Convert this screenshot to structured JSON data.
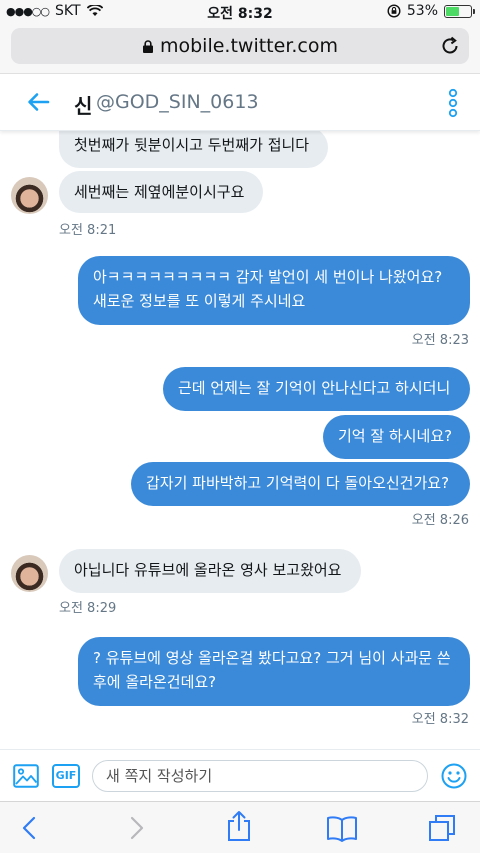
{
  "status_bar": {
    "signal": "●●●○○",
    "carrier": "SKT",
    "time": "오전 8:32",
    "battery": "53%",
    "battery_level": 0.53
  },
  "browser": {
    "url": "mobile.twitter.com"
  },
  "dm_header": {
    "name": "신",
    "handle": "@GOD_SIN_0613"
  },
  "messages": [
    {
      "direction": "received",
      "text": "첫번째가 뒷분이시고 두번째가 접니다"
    },
    {
      "direction": "received",
      "text": "세번째는 제옆에분이시구요"
    },
    {
      "direction": "received",
      "time": "오전 8:21"
    },
    {
      "direction": "sent",
      "text": "아ㅋㅋㅋㅋㅋㅋㅋㅋㅋ 감자 발언이 세 번이나 나왔어요? 새로운 정보를 또 이렇게 주시네요",
      "time": "오전 8:23"
    },
    {
      "direction": "sent",
      "text": "근데 언제는 잘 기억이 안나신다고 하시더니"
    },
    {
      "direction": "sent",
      "text": "기억 잘 하시네요?"
    },
    {
      "direction": "sent",
      "text": "갑자기 파바박하고 기억력이 다 돌아오신건가요?",
      "time": "오전 8:26"
    },
    {
      "direction": "received",
      "text": "아닙니다 유튜브에 올라온 영사 보고왔어요",
      "time": "오전 8:29"
    },
    {
      "direction": "sent",
      "text": "? 유튜브에 영상 올라온걸 봤다고요? 그거 님이 사과문 쓴 후에 올라온건데요?",
      "time": "오전 8:32"
    }
  ],
  "compose": {
    "placeholder": "새 쪽지 작성하기",
    "gif_label": "GIF"
  },
  "colors": {
    "sent_bubble": "#3a8ad9",
    "received_bubble": "#e6ecf0",
    "accent": "#1da1f2"
  },
  "icons": [
    "back-arrow-icon",
    "more-vertical-icon",
    "photo-icon",
    "gif-icon",
    "emoji-icon",
    "lock-icon",
    "reload-icon",
    "safari-back-icon",
    "safari-forward-icon",
    "share-icon",
    "bookmarks-icon",
    "tabs-icon"
  ]
}
